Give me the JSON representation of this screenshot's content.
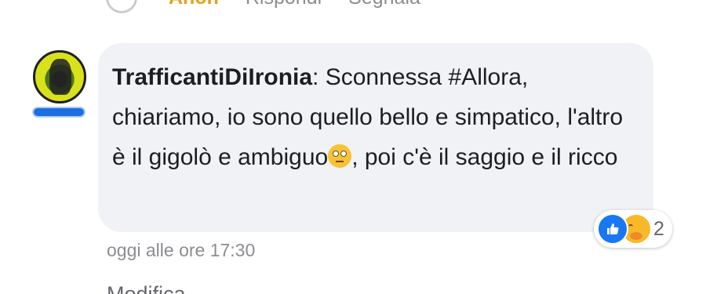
{
  "previous_comment": {
    "actions": [
      "Anon",
      "Rispondi",
      "Segnala"
    ]
  },
  "comment": {
    "author": "TrafficantiDiIronia",
    "separator": ":",
    "text_part1": " Sconnessa #Allora, chiariamo, io sono quello bello e simpatico, l'altro è il gigolò e ambiguo",
    "emoji": "face-with-rolling-eyes-icon",
    "text_part2": ", poi c'è il saggio e il ricco",
    "timestamp": "oggi alle ore 17:30",
    "reactions": {
      "icons": [
        "like-icon",
        "care-icon"
      ],
      "count": "2"
    },
    "next_action": "Modifica"
  },
  "colors": {
    "bubble_bg": "#f0f2f5",
    "like_blue": "#1877f2",
    "muted_text": "#8a8d91",
    "badge_blue": "#1b6fde"
  }
}
